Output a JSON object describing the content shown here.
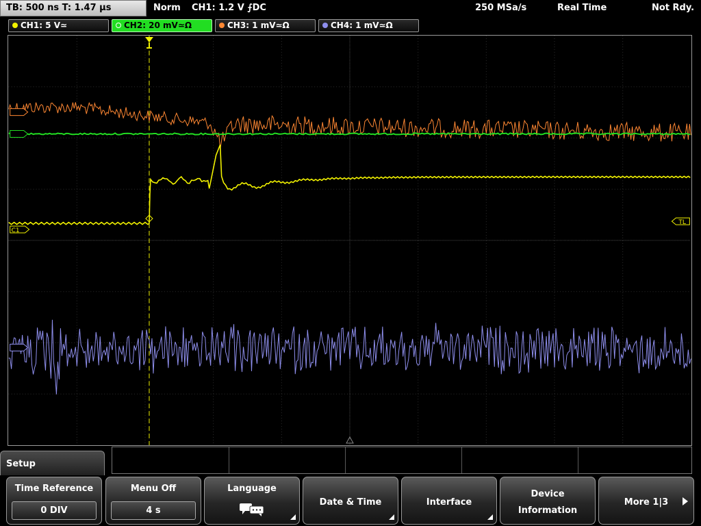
{
  "status": {
    "timebase": "TB: 500 ns   T: 1.47 µs",
    "trigger_mode": "Norm",
    "trigger_source": "CH1: 1.2 V ⨍DC",
    "sample_rate": "250 MSa/s",
    "acq_mode": "Real Time",
    "state": "Not Rdy."
  },
  "channels": [
    {
      "label": "CH1: 5 V≃",
      "color": "#f2f200",
      "active": false
    },
    {
      "label": "CH2: 20 mV≃Ω",
      "color": "#22dd22",
      "active": true
    },
    {
      "label": "CH3: 1 mV≃Ω",
      "color": "#ff8833",
      "active": false
    },
    {
      "label": "CH4: 1 mV≃Ω",
      "color": "#8f8fee",
      "active": false
    }
  ],
  "markers": {
    "ch1": "C1",
    "trigger_level": "TL"
  },
  "menu": {
    "title": "Setup",
    "softkeys": [
      {
        "label": "Time Reference",
        "value": "0 DIV"
      },
      {
        "label": "Menu Off",
        "value": "4 s"
      },
      {
        "label": "Language",
        "icon": "speech-bubbles-icon"
      },
      {
        "label": "Date & Time"
      },
      {
        "label": "Interface"
      },
      {
        "line1": "Device",
        "line2": "Information"
      },
      {
        "label": "More 1|3"
      }
    ]
  }
}
